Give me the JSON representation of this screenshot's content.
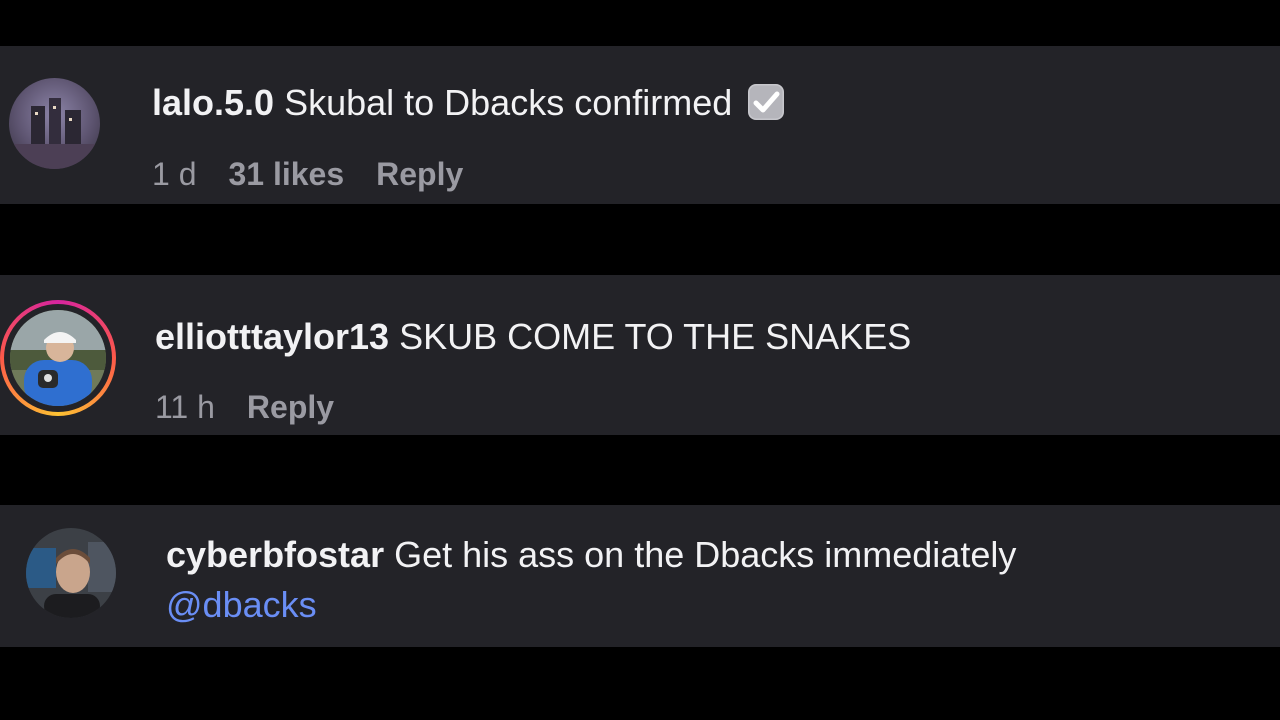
{
  "comments": [
    {
      "username": "lalo.5.0",
      "text": " Skubal to Dbacks confirmed ",
      "time": "1 d",
      "likes": "31 likes",
      "reply": "Reply",
      "emoji": "check-mark-button-icon"
    },
    {
      "username": "elliotttaylor13",
      "text": " SKUB COME TO THE SNAKES",
      "time": "11 h",
      "reply": "Reply",
      "story_ring": true
    },
    {
      "username": "cyberbfostar",
      "text": " Get his ass on the Dbacks immediately",
      "mention": "@dbacks"
    }
  ],
  "colors": {
    "background": "#000000",
    "card": "#232328",
    "text": "#f2f2f4",
    "meta": "#9a9aa2",
    "mention": "#6a8ef5"
  }
}
